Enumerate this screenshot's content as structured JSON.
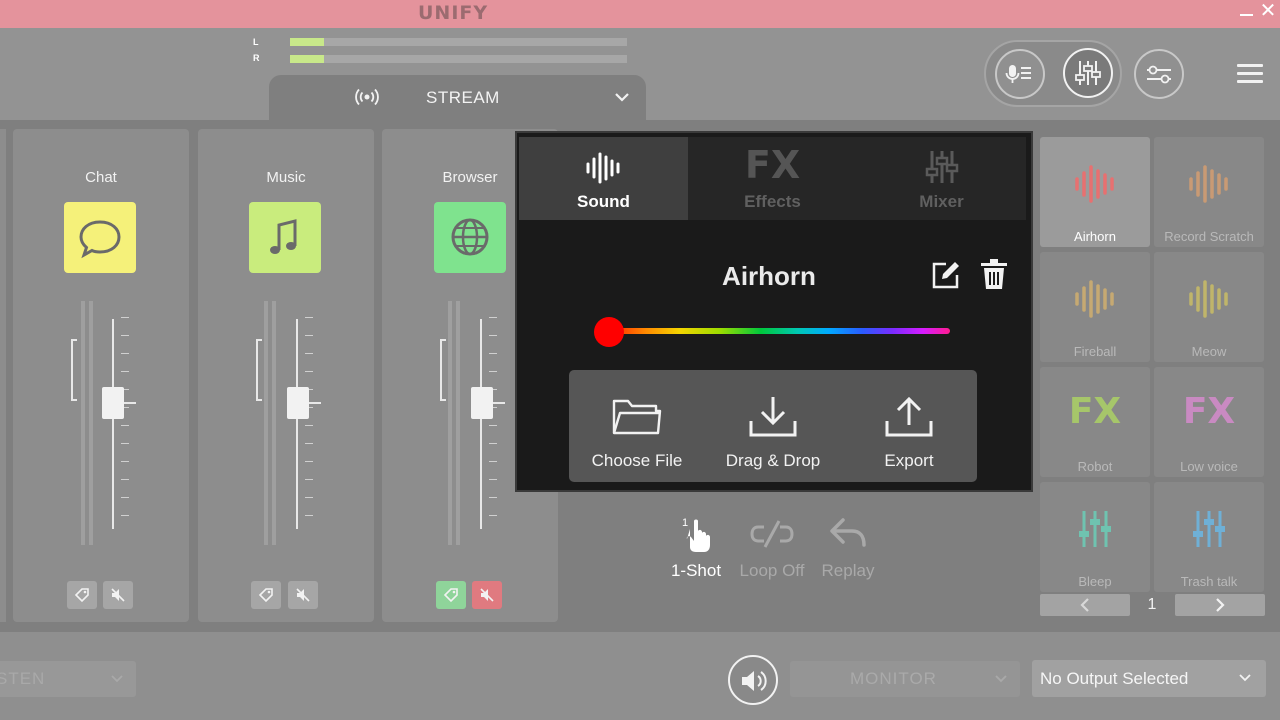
{
  "app": {
    "logo": "UNIFY"
  },
  "window": {
    "minimize_label": "",
    "close_label": "✕"
  },
  "meters": {
    "left_label": "L",
    "right_label": "R",
    "left_level": 0.1,
    "right_level": 0.1,
    "level_color": "#c8e88a"
  },
  "stream_selector": {
    "label": "STREAM"
  },
  "channels": [
    {
      "label": "Chat",
      "color": "#f5f17a",
      "icon": "chat-bubble-icon",
      "active": false
    },
    {
      "label": "Music",
      "color": "#c9ec7d",
      "icon": "music-note-icon",
      "active": false
    },
    {
      "label": "Browser",
      "color": "#7fe38e",
      "icon": "globe-icon",
      "active": true
    }
  ],
  "popup": {
    "tabs": [
      {
        "label": "Sound",
        "icon": "sound-wave-icon",
        "active": true
      },
      {
        "label": "Effects",
        "icon": "fx-icon",
        "glyph": "FX",
        "active": false
      },
      {
        "label": "Mixer",
        "icon": "mixer-sliders-icon",
        "active": false
      }
    ],
    "sound_name": "Airhorn",
    "color_level": 0.0,
    "actions": [
      {
        "label": "Choose File",
        "icon": "folder-icon"
      },
      {
        "label": "Drag & Drop",
        "icon": "download-icon"
      },
      {
        "label": "Export",
        "icon": "upload-icon"
      }
    ]
  },
  "playback_modes": [
    {
      "label": "1-Shot",
      "icon": "tap-icon",
      "badge": "1",
      "active": true
    },
    {
      "label": "Loop Off",
      "icon": "loop-off-icon",
      "active": false
    },
    {
      "label": "Replay",
      "icon": "replay-icon",
      "active": false
    }
  ],
  "sound_grid": {
    "cells": [
      {
        "label": "Airhorn",
        "icon": "sound-wave-icon",
        "color": "#e87070",
        "selected": true
      },
      {
        "label": "Record Scratch",
        "icon": "sound-wave-icon",
        "color": "#c99a74"
      },
      {
        "label": "Fireball",
        "icon": "sound-wave-icon",
        "color": "#c6a972"
      },
      {
        "label": "Meow",
        "icon": "sound-wave-icon",
        "color": "#c0b56a"
      },
      {
        "label": "Robot",
        "icon": "fx-icon",
        "glyph": "FX",
        "color": "#a6c66a"
      },
      {
        "label": "Low voice",
        "icon": "fx-icon",
        "glyph": "FX",
        "color": "#c98ac2"
      },
      {
        "label": "Bleep",
        "icon": "mixer-sliders-icon",
        "color": "#6fc3b0"
      },
      {
        "label": "Trash talk",
        "icon": "mixer-sliders-icon",
        "color": "#6fb0d6"
      }
    ],
    "page": "1"
  },
  "bottom_bar": {
    "listen_label": "STEN",
    "monitor_label": "MONITOR",
    "output_label": "No Output Selected"
  }
}
